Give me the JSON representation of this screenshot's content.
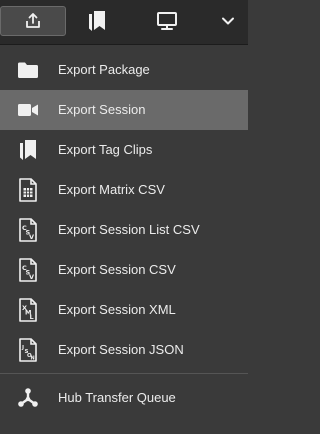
{
  "toolbar": {
    "buttons": [
      {
        "icon": "export-icon",
        "active": true
      },
      {
        "icon": "bookmarks-icon",
        "active": false
      },
      {
        "icon": "monitor-icon",
        "active": false
      },
      {
        "icon": "chevron-down-icon",
        "active": false
      }
    ]
  },
  "menu": {
    "items": [
      {
        "label": "Export Package",
        "icon": "folder-icon"
      },
      {
        "label": "Export Session",
        "icon": "video-camera-icon",
        "highlighted": true
      },
      {
        "label": "Export Tag Clips",
        "icon": "bookmark-icon"
      },
      {
        "label": "Export Matrix CSV",
        "icon": "matrix-file-icon"
      },
      {
        "label": "Export Session List CSV",
        "icon": "csv-file-icon"
      },
      {
        "label": "Export Session CSV",
        "icon": "csv-file-icon"
      },
      {
        "label": "Export Session XML",
        "icon": "xml-file-icon"
      },
      {
        "label": "Export Session JSON",
        "icon": "json-file-icon"
      }
    ],
    "footer_item": {
      "label": "Hub Transfer Queue",
      "icon": "hub-transfer-icon"
    }
  },
  "colors": {
    "background": "#3a3a3a",
    "toolbar": "#2a2a2a",
    "highlight": "#6a6a6a",
    "text": "#ececec"
  }
}
